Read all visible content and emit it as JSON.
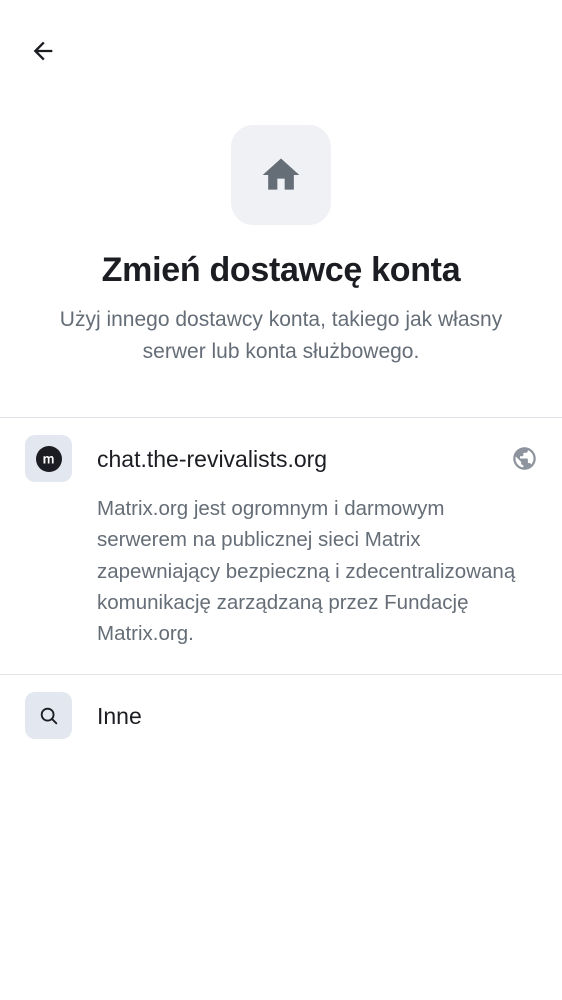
{
  "header": {
    "back_label": "Back"
  },
  "hero": {
    "icon": "home-icon",
    "title": "Zmień dostawcę konta",
    "subtitle": "Użyj innego dostawcy konta, takiego jak własny serwer lub konta służbowego."
  },
  "providers": [
    {
      "icon": "matrix-logo-icon",
      "name": "chat.the-revivalists.org",
      "description": "Matrix.org jest ogromnym i darmowym serwerem na publicznej sieci Matrix zapewniający bezpieczną i zdecentralizowaną komunikację zarządzaną przez Fundację Matrix.org.",
      "trailing_icon": "globe-icon"
    },
    {
      "icon": "search-icon",
      "name": "Inne"
    }
  ],
  "colors": {
    "text_primary": "#1b1d22",
    "text_secondary": "#656d77",
    "icon_surface": "#eff1f5",
    "divider": "#e1e3e8"
  }
}
